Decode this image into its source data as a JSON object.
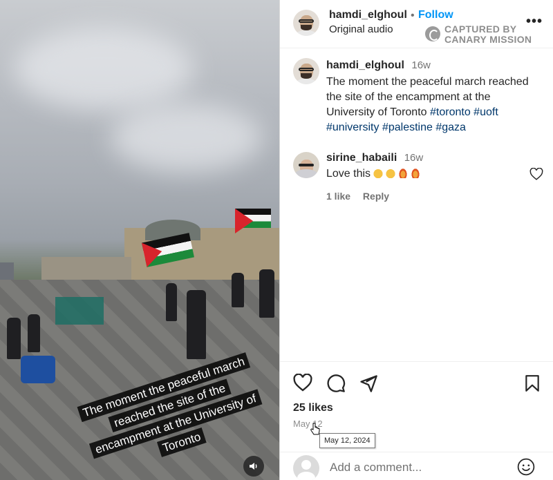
{
  "media": {
    "overlay_lines": [
      "The moment the peaceful march",
      "reached the site of the",
      "encampment at the University of",
      "Toronto"
    ]
  },
  "header": {
    "username": "hamdi_elghoul",
    "separator": "•",
    "follow_label": "Follow",
    "audio_label": "Original audio",
    "watermark_line1": "CAPTURED BY",
    "watermark_line2": "CANARY MISSION",
    "more_label": "•••"
  },
  "post": {
    "username": "hamdi_elghoul",
    "time": "16w",
    "caption_plain": "The moment the peaceful march reached the site of the encampment at the University of Toronto",
    "hashtags": [
      "#toronto",
      "#uoft",
      "#university",
      "#palestine",
      "#gaza"
    ]
  },
  "comment": {
    "username": "sirine_habaili",
    "time": "16w",
    "text": "Love this",
    "emojis": [
      "clap",
      "clap",
      "fire",
      "fire"
    ],
    "likes": "1 like",
    "reply": "Reply"
  },
  "actions": {
    "likes": "25 likes",
    "date": "May 12",
    "tooltip": "May 12, 2024",
    "comment_placeholder": "Add a comment..."
  }
}
